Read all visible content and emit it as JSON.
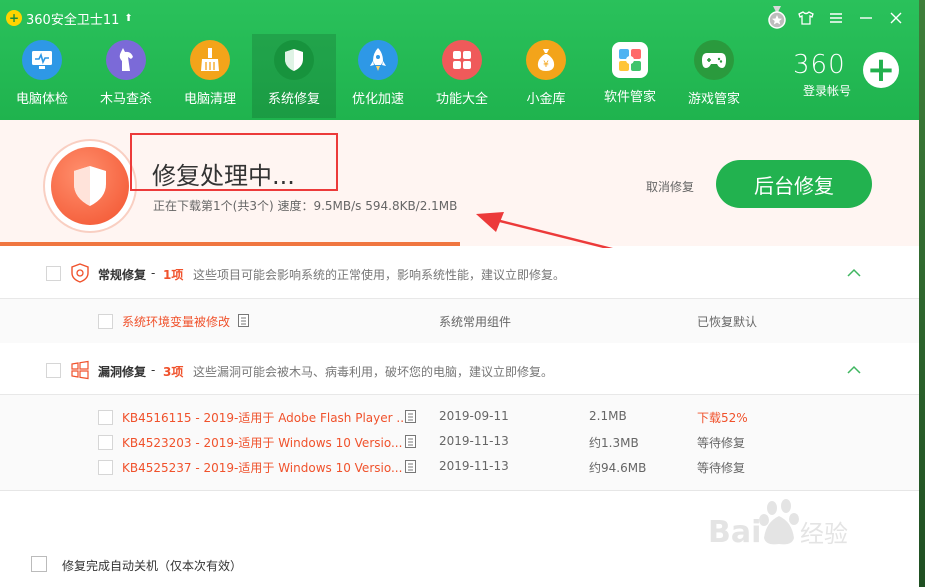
{
  "app": {
    "title": "360安全卫士11",
    "controls": [
      "shirt-icon",
      "menu-icon",
      "minimize-icon",
      "close-icon"
    ]
  },
  "nav": [
    {
      "label": "电脑体检",
      "icon": "monitor-icon",
      "color": "#2e98e6",
      "active": false
    },
    {
      "label": "木马查杀",
      "icon": "horse-icon",
      "color": "#7b6ad8",
      "active": false
    },
    {
      "label": "电脑清理",
      "icon": "broom-icon",
      "color": "#f3a41a",
      "active": false
    },
    {
      "label": "系统修复",
      "icon": "shield-icon",
      "color": "#20a447",
      "active": true
    },
    {
      "label": "优化加速",
      "icon": "rocket-icon",
      "color": "#2e98e6",
      "active": false
    },
    {
      "label": "功能大全",
      "icon": "grid-icon",
      "color": "#ef5a5a",
      "active": false
    },
    {
      "label": "小金库",
      "icon": "money-bag-icon",
      "color": "#f3a41a",
      "active": false
    },
    {
      "label": "软件管家",
      "icon": "apps-icon",
      "color": "#ffffff",
      "active": false
    },
    {
      "label": "游戏管家",
      "icon": "gamepad-icon",
      "color": "#2a9a3d",
      "active": false
    }
  ],
  "account": {
    "logo_text": "360",
    "label": "登录帐号"
  },
  "status": {
    "title": "修复处理中...",
    "detail": "正在下载第1个(共3个) 速度：9.5MB/s  594.8KB/2.1MB",
    "cancel_label": "取消修复",
    "bg_button_label": "后台修复",
    "progress_fraction": 0.5,
    "accent": "#f0522c",
    "button_color": "#22b24f"
  },
  "sections": {
    "general": {
      "title": "常规修复",
      "count": "1项",
      "desc": "这些项目可能会影响系统的正常使用，影响系统性能，建议立即修复。",
      "items": [
        {
          "name": "系统环境变量被修改",
          "category": "系统常用组件",
          "status": "已恢复默认"
        }
      ]
    },
    "vuln": {
      "title": "漏洞修复",
      "count": "3项",
      "desc": "这些漏洞可能会被木马、病毒利用，破坏您的电脑，建议立即修复。",
      "items": [
        {
          "name": "KB4516115 - 2019-适用于 Adobe Flash Player ...",
          "date": "2019-09-11",
          "size": "2.1MB",
          "status": "下载52%"
        },
        {
          "name": "KB4523203 - 2019-适用于 Windows 10 Versio...",
          "date": "2019-11-13",
          "size": "约1.3MB",
          "status": "等待修复"
        },
        {
          "name": "KB4525237 - 2019-适用于 Windows 10 Versio...",
          "date": "2019-11-13",
          "size": "约94.6MB",
          "status": "等待修复"
        }
      ]
    }
  },
  "footer": {
    "auto_shutdown_label": "修复完成自动关机（仅本次有效）"
  },
  "watermark": {
    "brand": "Baidu 经验",
    "url": "jingyan.baidu.com"
  }
}
